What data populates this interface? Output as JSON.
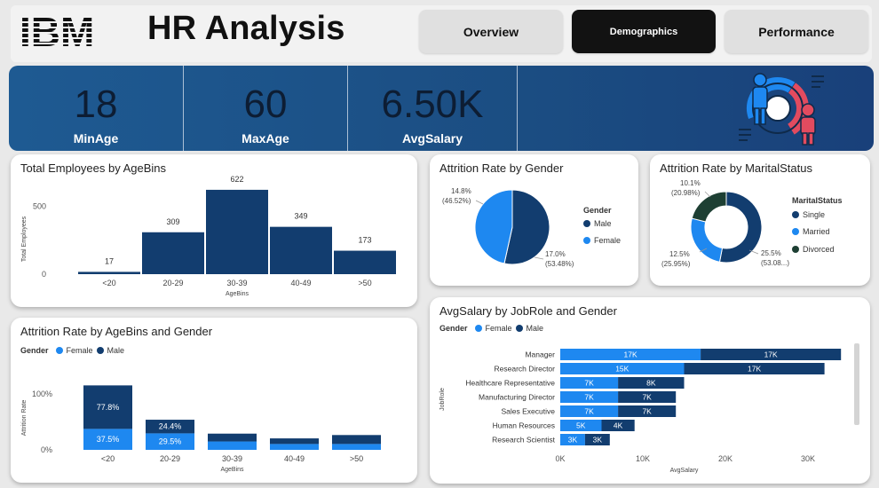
{
  "header": {
    "logo_text": "IBM",
    "title": "HR Analysis",
    "nav": [
      {
        "label": "Overview",
        "active": false
      },
      {
        "label": "Demographics",
        "active": true
      },
      {
        "label": "Performance",
        "active": false
      }
    ]
  },
  "kpis": [
    {
      "value": "18",
      "label": "MinAge"
    },
    {
      "value": "60",
      "label": "MaxAge"
    },
    {
      "value": "6.50K",
      "label": "AvgSalary"
    }
  ],
  "colors": {
    "male": "#123d6f",
    "female": "#1e88f0",
    "divorced": "#1d3f33",
    "kpi_band": "#1e5a92"
  },
  "icons": {
    "kpi_illustration": "demographics-donut-people-icon"
  },
  "cards": {
    "employees_by_agebins": {
      "title": "Total Employees by AgeBins"
    },
    "attrition_by_gender": {
      "title": "Attrition Rate by Gender",
      "legend_title": "Gender",
      "legend": [
        "Male",
        "Female"
      ]
    },
    "attrition_by_marital": {
      "title": "Attrition Rate by MaritalStatus",
      "legend_title": "MaritalStatus",
      "legend": [
        "Single",
        "Married",
        "Divorced"
      ]
    },
    "attrition_by_agebins_gender": {
      "title": "Attrition Rate by AgeBins and Gender",
      "legend_title": "Gender",
      "legend": [
        "Female",
        "Male"
      ]
    },
    "avgsalary_by_jobrole_gender": {
      "title": "AvgSalary by JobRole and Gender",
      "legend_title": "Gender",
      "legend": [
        "Female",
        "Male"
      ]
    }
  },
  "chart_data": [
    {
      "id": "employees_by_agebins",
      "type": "bar",
      "title": "Total Employees by AgeBins",
      "xlabel": "AgeBins",
      "ylabel": "Total Employees",
      "categories": [
        "<20",
        "20-29",
        "30-39",
        "40-49",
        ">50"
      ],
      "values": [
        17,
        309,
        622,
        349,
        173
      ],
      "data_labels": [
        "17",
        "309",
        "622",
        "349",
        "173"
      ],
      "y_ticks": [
        0,
        500
      ],
      "y_tick_labels": [
        "0",
        "500"
      ],
      "ylim": [
        0,
        700
      ]
    },
    {
      "id": "attrition_by_gender",
      "type": "pie",
      "title": "Attrition Rate by Gender",
      "slices": [
        {
          "name": "Male",
          "value": 17.0,
          "label": "17.0%",
          "sublabel": "(53.48%)"
        },
        {
          "name": "Female",
          "value": 14.8,
          "label": "14.8%",
          "sublabel": "(46.52%)"
        }
      ]
    },
    {
      "id": "attrition_by_marital",
      "type": "pie",
      "title": "Attrition Rate by MaritalStatus",
      "donut": true,
      "slices": [
        {
          "name": "Single",
          "value": 25.5,
          "label": "25.5%",
          "sublabel": "(53.08...)"
        },
        {
          "name": "Married",
          "value": 12.5,
          "label": "12.5%",
          "sublabel": "(25.95%)"
        },
        {
          "name": "Divorced",
          "value": 10.1,
          "label": "10.1%",
          "sublabel": "(20.98%)"
        }
      ]
    },
    {
      "id": "attrition_by_agebins_gender",
      "type": "bar",
      "stacked": true,
      "title": "Attrition Rate by AgeBins and Gender",
      "xlabel": "AgeBins",
      "ylabel": "Attrition Rate",
      "categories": [
        "<20",
        "20-29",
        "30-39",
        "40-49",
        ">50"
      ],
      "series": [
        {
          "name": "Female",
          "values": [
            37.5,
            29.5,
            15.0,
            10.5,
            10.5
          ],
          "labels": [
            "37.5%",
            "29.5%",
            "",
            "",
            ""
          ]
        },
        {
          "name": "Male",
          "values": [
            77.8,
            24.4,
            14.0,
            10.0,
            16.0
          ],
          "labels": [
            "77.8%",
            "24.4%",
            "",
            "",
            ""
          ]
        }
      ],
      "y_ticks": [
        0,
        100
      ],
      "y_tick_labels": [
        "0%",
        "100%"
      ],
      "ylim": [
        0,
        125
      ]
    },
    {
      "id": "avgsalary_by_jobrole_gender",
      "type": "bar",
      "orientation": "horizontal",
      "stacked": true,
      "title": "AvgSalary by JobRole and Gender",
      "xlabel": "AvgSalary",
      "ylabel": "JobRole",
      "categories": [
        "Manager",
        "Research Director",
        "Healthcare Representative",
        "Manufacturing Director",
        "Sales Executive",
        "Human Resources",
        "Research Scientist"
      ],
      "series": [
        {
          "name": "Female",
          "values": [
            17,
            15,
            7,
            7,
            7,
            5,
            3
          ],
          "labels": [
            "17K",
            "15K",
            "7K",
            "7K",
            "7K",
            "5K",
            "3K"
          ]
        },
        {
          "name": "Male",
          "values": [
            17,
            17,
            8,
            7,
            7,
            4,
            3
          ],
          "labels": [
            "17K",
            "17K",
            "8K",
            "7K",
            "7K",
            "4K",
            "3K"
          ]
        }
      ],
      "x_ticks": [
        0,
        10,
        20,
        30
      ],
      "x_tick_labels": [
        "0K",
        "10K",
        "20K",
        "30K"
      ],
      "xlim": [
        0,
        36
      ]
    }
  ]
}
